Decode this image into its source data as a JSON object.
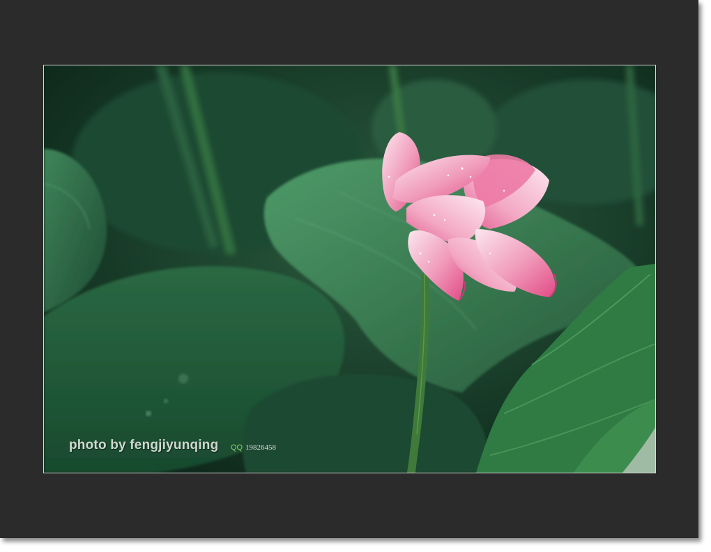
{
  "watermark": {
    "credit": "photo by fengjiyunqing",
    "qq_label": "QQ",
    "qq_number": "19826458"
  },
  "colors": {
    "frame": "#2b2b2b",
    "leaf_dark": "#173f2a",
    "leaf_mid": "#2f6b48",
    "leaf_light": "#4f9466",
    "petal_pink": "#e6578f",
    "petal_light": "#f7d6e3",
    "stem": "#3f7a3a"
  }
}
